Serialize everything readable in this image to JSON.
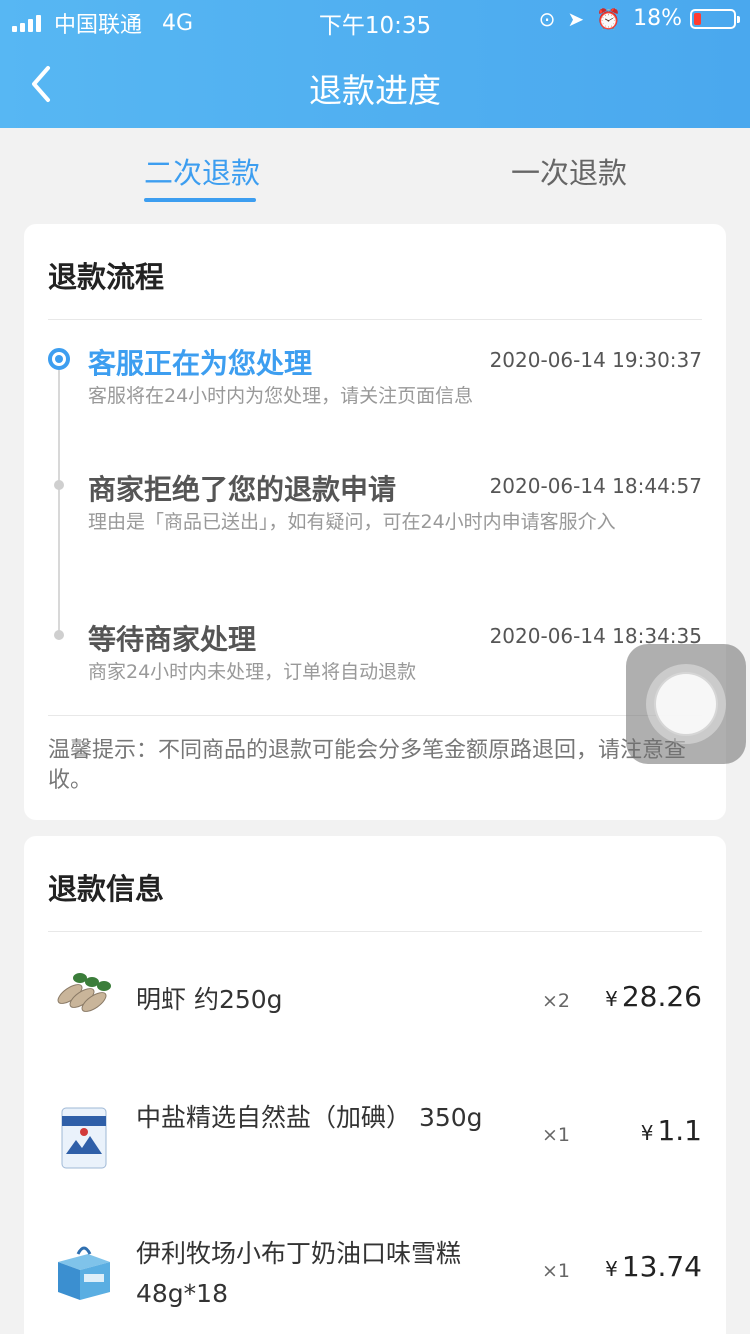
{
  "status_bar": {
    "carrier": "中国联通",
    "network": "4G",
    "time": "下午10:35",
    "battery": "18%",
    "battery_level": 0.18
  },
  "header": {
    "title": "退款进度"
  },
  "tabs": [
    {
      "label": "二次退款",
      "active": true
    },
    {
      "label": "一次退款",
      "active": false
    }
  ],
  "process": {
    "title": "退款流程",
    "steps": [
      {
        "title": "客服正在为您处理",
        "time": "2020-06-14 19:30:37",
        "desc": "客服将在24小时内为您处理，请关注页面信息"
      },
      {
        "title": "商家拒绝了您的退款申请",
        "time": "2020-06-14 18:44:57",
        "desc": "理由是「商品已送出」，如有疑问，可在24小时内申请客服介入"
      },
      {
        "title": "等待商家处理",
        "time": "2020-06-14 18:34:35",
        "desc": "商家24小时内未处理，订单将自动退款"
      }
    ],
    "tip": "温馨提示：不同商品的退款可能会分多笔金额原路退回，请注意查收。"
  },
  "refund_info": {
    "title": "退款信息",
    "items": [
      {
        "name": "明虾 约250g",
        "qty": "×2",
        "currency": "¥",
        "price": "28.26"
      },
      {
        "name": "中盐精选自然盐（加碘） 350g",
        "qty": "×1",
        "currency": "¥",
        "price": "1.1"
      },
      {
        "name": "伊利牧场小布丁奶油口味雪糕 48g*18",
        "qty": "×1",
        "currency": "¥",
        "price": "13.74"
      }
    ]
  },
  "colors": {
    "accent": "#3d9ef0",
    "header": "#4aa8ee"
  }
}
